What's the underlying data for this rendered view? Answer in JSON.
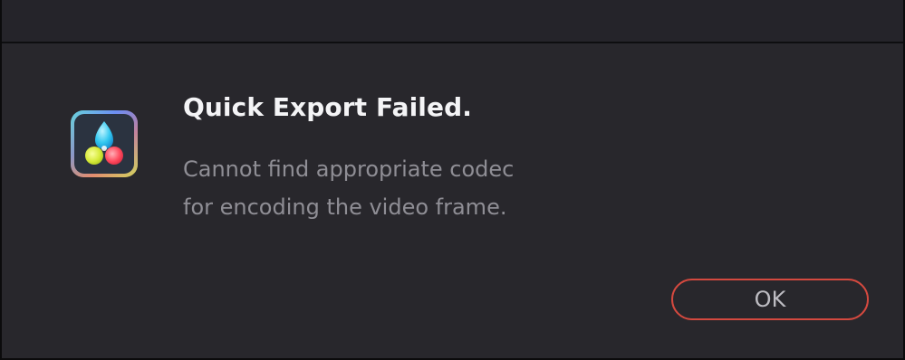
{
  "dialog": {
    "icon": "davinci-resolve-app-icon",
    "title": "Quick Export Failed.",
    "message_line1": "Cannot find appropriate codec",
    "message_line2": "for encoding the video frame.",
    "ok_label": "OK"
  },
  "colors": {
    "background": "#28272c",
    "title": "#f4f4f6",
    "message": "#8f8e95",
    "button_border": "#d4493f"
  }
}
